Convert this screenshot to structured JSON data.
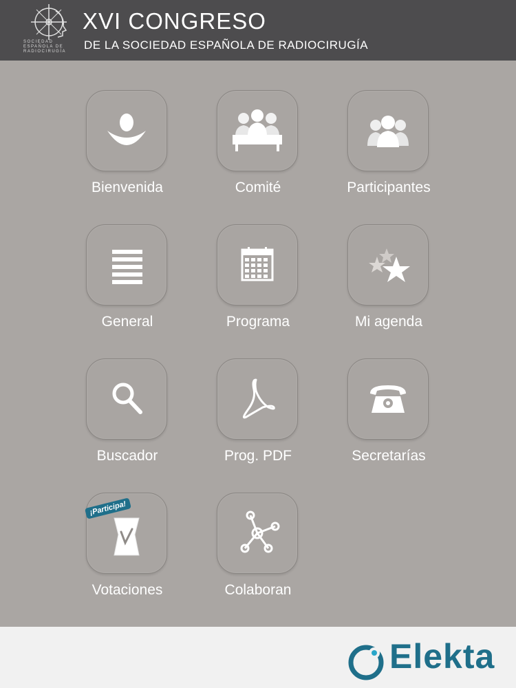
{
  "header": {
    "title_main": "XVI CONGRESO",
    "title_sub": "DE LA SOCIEDAD ESPAÑOLA DE RADIOCIRUGÍA",
    "logo_lines": [
      "SOCIEDAD",
      "ESPAÑOLA DE",
      "RADIOCIRUGÍA"
    ]
  },
  "menu": [
    {
      "label": "Bienvenida",
      "icon": "welcome-icon"
    },
    {
      "label": "Comité",
      "icon": "committee-icon"
    },
    {
      "label": "Participantes",
      "icon": "participants-icon"
    },
    {
      "label": "General",
      "icon": "list-icon"
    },
    {
      "label": "Programa",
      "icon": "calendar-icon"
    },
    {
      "label": "Mi agenda",
      "icon": "stars-icon"
    },
    {
      "label": "Buscador",
      "icon": "search-icon"
    },
    {
      "label": "Prog. PDF",
      "icon": "pdf-icon"
    },
    {
      "label": "Secretarías",
      "icon": "telephone-icon"
    },
    {
      "label": "Votaciones",
      "icon": "ballot-icon",
      "badge": "¡Participa!"
    },
    {
      "label": "Colaboran",
      "icon": "network-icon"
    }
  ],
  "footer": {
    "brand": "Elekta"
  },
  "colors": {
    "header_bg": "#4d4c4e",
    "grid_bg": "#aaa6a3",
    "footer_bg": "#f1f1f1",
    "brand": "#1f6f8a",
    "badge": "#1f6f8a"
  }
}
